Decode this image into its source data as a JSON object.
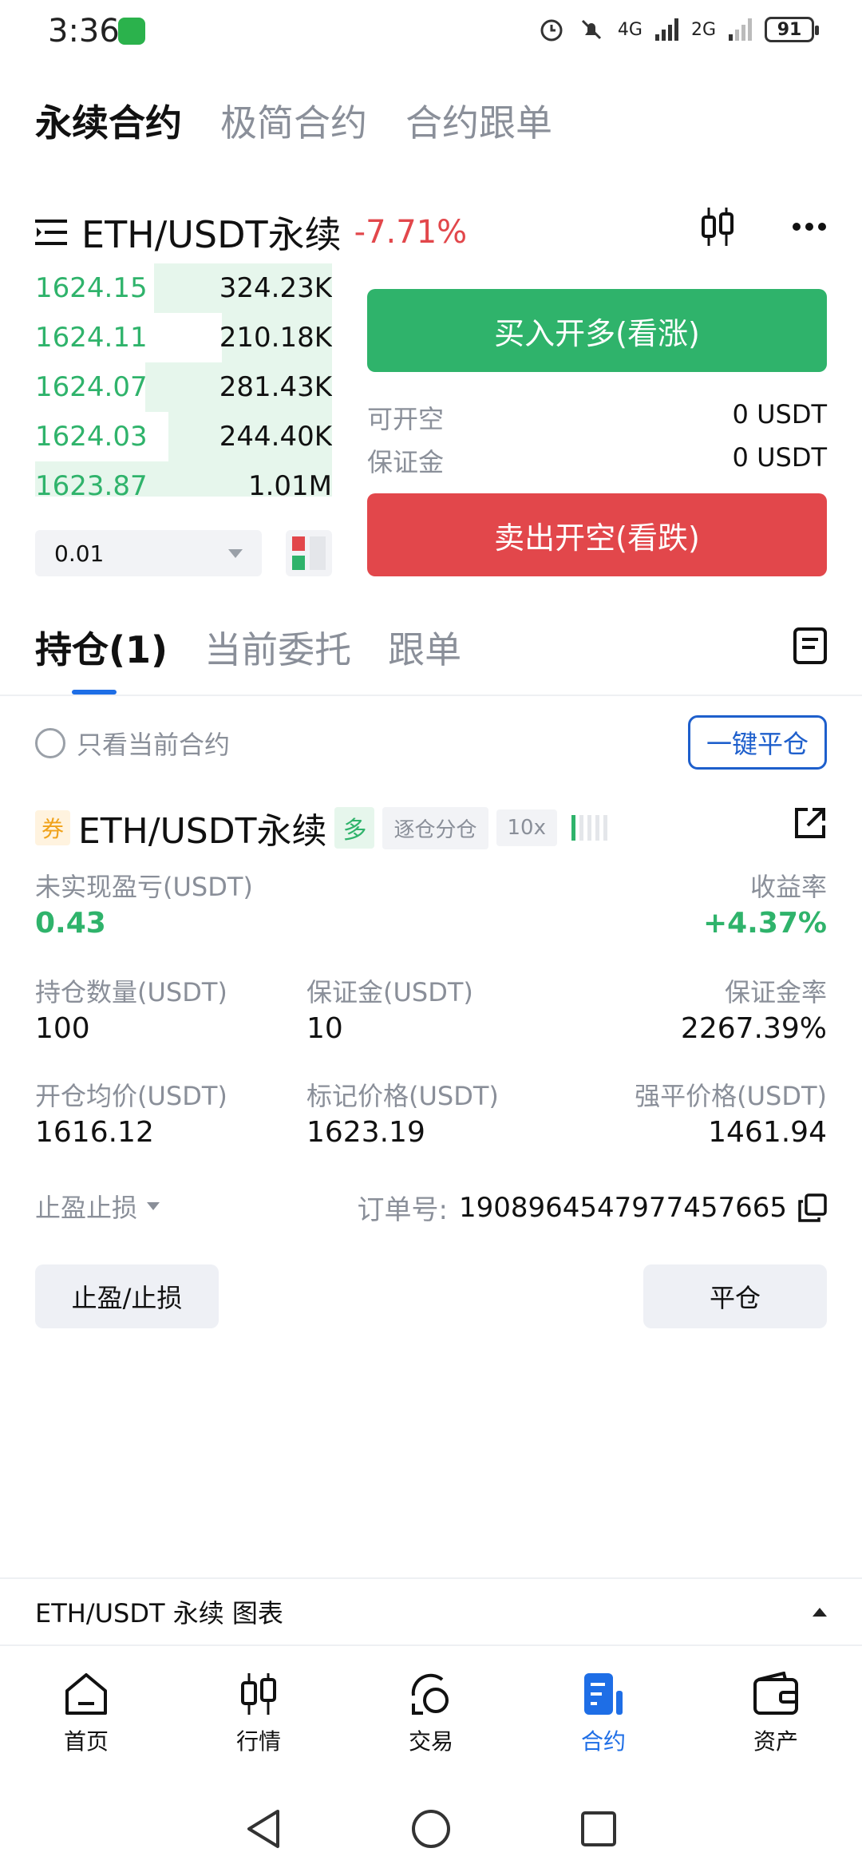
{
  "status_bar": {
    "time": "3:36",
    "network": "4G",
    "network2": "2G",
    "battery": "91"
  },
  "top_tabs": [
    "永续合约",
    "极简合约",
    "合约跟单"
  ],
  "symbol_header": {
    "symbol": "ETH/USDT永续",
    "change": "-7.71%"
  },
  "order_book": {
    "rows": [
      {
        "price": "1624.15",
        "qty": "324.23K",
        "depth_pct": 60
      },
      {
        "price": "1624.11",
        "qty": "210.18K",
        "depth_pct": 37
      },
      {
        "price": "1624.07",
        "qty": "281.43K",
        "depth_pct": 63
      },
      {
        "price": "1624.03",
        "qty": "244.40K",
        "depth_pct": 55
      },
      {
        "price": "1623.87",
        "qty": "1.01M",
        "depth_pct": 100
      }
    ],
    "qty_step": "0.01"
  },
  "trade": {
    "buy_label": "买入开多(看涨)",
    "sell_label": "卖出开空(看跌)",
    "available_label": "可开空",
    "available_value": "0 USDT",
    "margin_label": "保证金",
    "margin_value": "0 USDT"
  },
  "position_tabs": [
    "持仓(1)",
    "当前委托",
    "跟单"
  ],
  "filter": {
    "only_current_label": "只看当前合约",
    "close_all_label": "一键平仓"
  },
  "position": {
    "coupon": "券",
    "symbol": "ETH/USDT永续",
    "side": "多",
    "margin_mode": "逐仓分仓",
    "leverage": "10x",
    "unrealized_pnl_label": "未实现盈亏(USDT)",
    "unrealized_pnl": "0.43",
    "roe_label": "收益率",
    "roe": "+4.37%",
    "size_label": "持仓数量(USDT)",
    "size": "100",
    "margin_label": "保证金(USDT)",
    "margin": "10",
    "margin_ratio_label": "保证金率",
    "margin_ratio": "2267.39%",
    "entry_label": "开仓均价(USDT)",
    "entry": "1616.12",
    "mark_label": "标记价格(USDT)",
    "mark": "1623.19",
    "liq_label": "强平价格(USDT)",
    "liq": "1461.94",
    "tpsl_dropdown": "止盈止损",
    "order_no_label": "订单号:",
    "order_no": "1908964547977457665",
    "tpsl_button": "止盈/止损",
    "close_button": "平仓"
  },
  "chart_bar": {
    "label": "ETH/USDT 永续 图表"
  },
  "bottom_nav": [
    {
      "label": "首页",
      "icon": "home-icon"
    },
    {
      "label": "行情",
      "icon": "candlestick-icon"
    },
    {
      "label": "交易",
      "icon": "exchange-icon"
    },
    {
      "label": "合约",
      "icon": "contract-icon"
    },
    {
      "label": "资产",
      "icon": "wallet-icon"
    }
  ],
  "colors": {
    "green": "#2fb36b",
    "red": "#e2474b",
    "blue": "#1e6ee6"
  }
}
